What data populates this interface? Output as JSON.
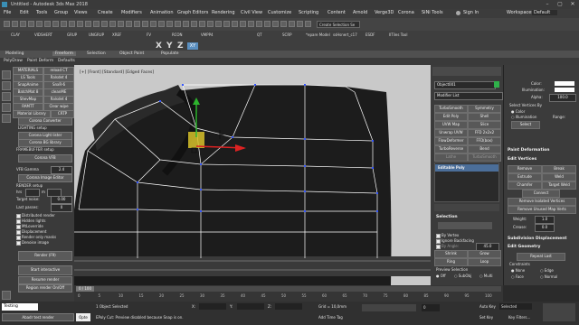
{
  "window": {
    "title": "Untitled - Autodesk 3ds Max 2018"
  },
  "menu": {
    "items": [
      "File",
      "Edit",
      "Tools",
      "Group",
      "Views",
      "Create",
      "Modifiers",
      "Animation",
      "Graph Editors",
      "Rendering",
      "Civil View",
      "Customize",
      "Scripting",
      "Content",
      "Arnold",
      "Verge3D",
      "Corona",
      "SiNi Tools"
    ],
    "sign_in": "Sign In",
    "workspaces_label": "Workspaces:",
    "workspaces_value": "Default"
  },
  "toolbar1": {
    "selection_set": "Create Selection Se"
  },
  "toolbar2": {
    "labels": [
      "CLAY",
      "VIDSHERT",
      "GRUP",
      "UNGRUP",
      "XREF",
      "FV",
      "RCON",
      "VMPP4",
      "QT",
      "SCRP",
      "*epare Model",
      "ssHsnert_c17",
      "ESDF",
      "IITiles Tool"
    ]
  },
  "ribbon": {
    "tabs": [
      "Modeling",
      "Freeform",
      "Selection",
      "Object Paint",
      "Populate"
    ],
    "sub_tabs": [
      "PolyDraw",
      "Paint Deform",
      "Defaults"
    ]
  },
  "viewport": {
    "label": "[+] [Front] [Standard] [Edged Faces]"
  },
  "left_panel": {
    "top_rows": [
      [
        "MATERIALS",
        "reload CT"
      ],
      [
        "LS Tools",
        "Ralsdet 4"
      ],
      [
        "SnapAnime",
        "SnxR-6"
      ],
      [
        "BatchMat 8",
        "cleanME"
      ],
      [
        "ShevMap",
        "Ralsdet 4"
      ],
      [
        "RAMTT",
        "Clear wipe"
      ],
      [
        "Material Library",
        "CRTP"
      ]
    ],
    "corona_converter": "Corona Converter",
    "lighting_setup": "LIGHTING setup",
    "corona_light_lister": "Corona Light lister",
    "corona_bg_library": "Corona BG library",
    "frame_buffer": "FRAMEBUFFER setup",
    "corona_vfb": "Corona VFB",
    "vfb_gamma": "VFB Gamma",
    "vfb_gamma_value": "2.4",
    "corona_image_editor": "Corona Image Editor",
    "render_setup": "RENDER setup",
    "hrs": "hrs",
    "m": "m",
    "target_noise": "Target noise:",
    "target_noise_value": "0.00",
    "last_passes": "Last passes:",
    "last_passes_value": "0",
    "checks": [
      "Distributed render",
      "Hidden lights",
      "MtLoverride",
      "Displacement",
      "Render only masks",
      "Denoise image"
    ],
    "render_btn": "Render (F9)",
    "start_interactive": "Start interactive",
    "resume_render": "Resume render",
    "region_render": "Region render On/Off"
  },
  "right_panel": {
    "object_name": "Object001",
    "modifier_list": "Modifier List",
    "mods": [
      [
        "TurboSmooth",
        "Symmetry"
      ],
      [
        "Edit Poly",
        "Shell"
      ],
      [
        "UVW Map",
        "Slice"
      ],
      [
        "Unwrap UVW",
        "FFD 2x2x2"
      ],
      [
        "FlowDeformer",
        "FFD(box)"
      ],
      [
        "TurboReverse",
        "Bend"
      ],
      [
        "Lathe",
        "TurboSmooth"
      ]
    ],
    "editable_poly": "Editable Poly",
    "selection": "Selection",
    "by_vertex": "By Vertex",
    "ignore_backfacing": "Ignore Backfacing",
    "by_angle": "By Angle:",
    "by_angle_value": "45.0",
    "shrink": "Shrink",
    "grow": "Grow",
    "ring": "Ring",
    "loop": "Loop",
    "preview_selection": "Preview Selection",
    "off": "Off",
    "subobj": "SubObj",
    "multi": "Multi"
  },
  "far_right": {
    "color": "Color:",
    "illumination": "Illumination:",
    "alpha": "Alpha:",
    "alpha_value": "100.0",
    "select_vertices_by": "Select Vertices By",
    "color_opt": "Color",
    "illumination_opt": "Illumination",
    "range": "Range:",
    "select": "Select",
    "paint_deformation": "Paint Deformation",
    "edit_vertices": "Edit Vertices",
    "remove": "Remove",
    "break": "Break",
    "extrude": "Extrude",
    "weld": "Weld",
    "chamfer": "Chamfer",
    "target_weld": "Target Weld",
    "connect": "Connect",
    "remove_isolated": "Remove Isolated Vertices",
    "remove_unused": "Remove Unused Map Verts",
    "weight": "Weight:",
    "weight_value": "1.0",
    "crease": "Crease:",
    "crease_value": "0.0",
    "subdivision_displacement": "Subdivision Displacement",
    "edit_geometry": "Edit Geometry",
    "repeat_last": "Repeat Last",
    "constraints": "Constraints",
    "none": "None",
    "edge": "Edge",
    "face": "Face",
    "normal": "Normal"
  },
  "timeline": {
    "frame": "0 / 100",
    "ticks": [
      "0",
      "5",
      "10",
      "15",
      "20",
      "25",
      "30",
      "35",
      "40",
      "45",
      "50",
      "55",
      "60",
      "65",
      "70",
      "75",
      "80",
      "85",
      "90",
      "95",
      "100"
    ]
  },
  "status": {
    "script_box": "Testing",
    "selected": "1 Object Selected",
    "prompt": "EPoly Cut: Preview disabled because Snap is on.",
    "x_label": "X:",
    "y_label": "Y:",
    "z_label": "Z:",
    "grid": "Grid = 10,0mm",
    "add_time_tag": "Add Time Tag",
    "auto_key": "Auto Key",
    "selected_dd": "Selected",
    "set_key": "Set Key",
    "key_filters": "Key Filters...",
    "frame_value": "0",
    "abs_label": "Abs",
    "abs_btn": "Abadr test render",
    "opte": "Opte"
  }
}
